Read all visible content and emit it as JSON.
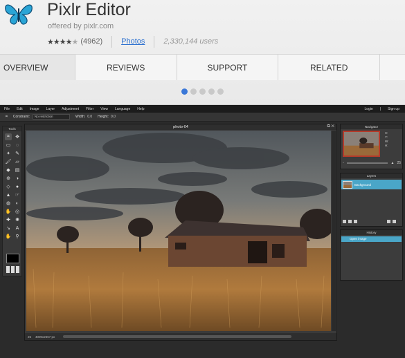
{
  "app": {
    "title": "Pixlr Editor",
    "offered_by": "offered by pixlr.com",
    "rating": 4,
    "rating_max": 5,
    "rating_count": "(4962)",
    "category": "Photos",
    "users": "2,330,144 users"
  },
  "tabs": [
    {
      "label": "OVERVIEW",
      "active": true
    },
    {
      "label": "REVIEWS"
    },
    {
      "label": "SUPPORT"
    },
    {
      "label": "RELATED"
    }
  ],
  "carousel": {
    "count": 5,
    "active_index": 0
  },
  "colors": {
    "accent": "#3b78d8",
    "layer_highlight": "#4aa6c8",
    "nav_frame": "#b43a2a"
  },
  "pixlr": {
    "menu": [
      "File",
      "Edit",
      "Image",
      "Layer",
      "Adjustment",
      "Filter",
      "View",
      "Language",
      "Help"
    ],
    "menu_right": [
      "Login",
      "Sign up"
    ],
    "options": {
      "constraint_label": "Constraint:",
      "constraint_value": "No restriction",
      "width_label": "Width:",
      "width_value": "0.0",
      "height_label": "Height:",
      "height_value": "0.0"
    },
    "tools_title": "Tools",
    "document": {
      "title": "photo-04",
      "zoom": "25",
      "size": "4000x2667 px"
    },
    "navigator": {
      "title": "Navigator",
      "x": "X:",
      "y": "Y:",
      "w": "W:",
      "h": "H:",
      "zoom": "25"
    },
    "layers": {
      "title": "Layers",
      "layer_name": "Background"
    },
    "history": {
      "title": "History",
      "entry": "Open image"
    }
  }
}
